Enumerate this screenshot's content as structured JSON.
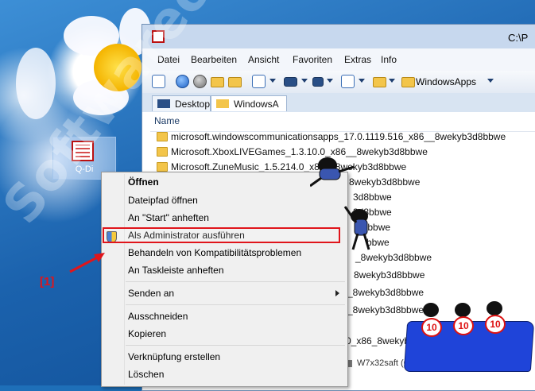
{
  "window": {
    "title": "C:\\P",
    "menu": [
      "Datei",
      "Bearbeiten",
      "Ansicht",
      "Favoriten",
      "Extras",
      "Info"
    ],
    "breadcrumb": "WindowsApps",
    "tabs": [
      {
        "label": "Desktop",
        "active": false
      },
      {
        "label": "WindowsA",
        "active": true
      }
    ],
    "column_header": "Name",
    "files": [
      "microsoft.windowscommunicationsapps_17.0.1119.516_x86__8wekyb3d8bbwe",
      "Microsoft.XboxLIVEGames_1.3.10.0_x86__8wekyb3d8bbwe",
      "Microsoft.ZuneMusic_1.5.214.0_x86__8wekyb3d8bbwe",
      "8wekyb3d8bbwe",
      "3d8bbwe",
      "3d8bbwe",
      "d8bbwe",
      "bbwe",
      "_8wekyb3d8bbwe",
      "8wekyb3d8bbwe",
      "_8wekyb3d8bbwe",
      "_8wekyb3d8bbwe",
      "0_x86_8wekyb3d8bbwe"
    ],
    "status_drive": "W7x32saft (G:)"
  },
  "desktop_icon": {
    "label": "Q-Di"
  },
  "context_menu": {
    "items": [
      {
        "label": "Öffnen",
        "bold": true
      },
      {
        "label": "Dateipfad öffnen"
      },
      {
        "label": "An \"Start\" anheften"
      },
      {
        "label": "Als Administrator ausführen",
        "icon": "uac-shield-icon",
        "highlighted": true
      },
      {
        "label": "Behandeln von Kompatibilitätsproblemen"
      },
      {
        "label": "An Taskleiste anheften"
      },
      {
        "label": "Senden an",
        "submenu": true
      },
      {
        "label": "Ausschneiden"
      },
      {
        "label": "Kopieren"
      },
      {
        "label": "Verknüpfung erstellen"
      },
      {
        "label": "Löschen"
      }
    ]
  },
  "annotation": {
    "label": "[1]",
    "color": "#e0151b"
  },
  "watermark": "Softwareok.de",
  "cartoon_badges": [
    "10",
    "10",
    "10"
  ]
}
